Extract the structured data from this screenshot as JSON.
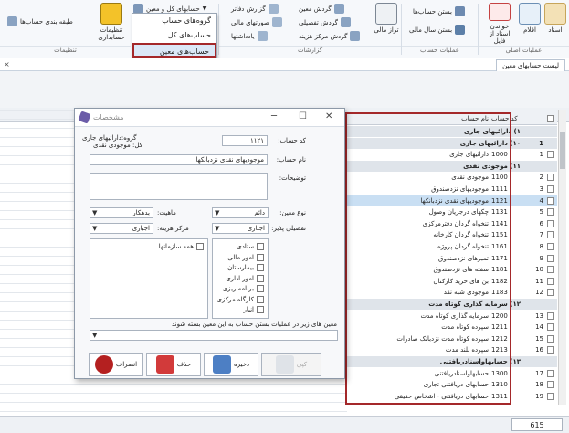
{
  "ribbon": {
    "groups": {
      "basic_ops": "عملیات اصلی",
      "account_ops": "عملیات حساب",
      "reports": "گزارشات",
      "settings": "تنظیمات"
    },
    "big_buttons": {
      "documents": "اسناد",
      "items": "اقلام",
      "read_doc": "خواندن اسناد از فایل",
      "accounting_settings": "تنظیمات حسابداری",
      "group_accounts": "طبقه بندی حساب‌ها"
    },
    "small_buttons": {
      "close_accounts": "بستن حساب‌ها",
      "close_fiscal_year": "بستن سال مالی",
      "trial_balance": "تراز مالی",
      "ledger_flow": "گردش معین",
      "detailed_flow": "گردش تفصیلی",
      "cost_center_flow": "گردش مرکز هزینه",
      "journal_report": "گزارش دفاتر",
      "financial_statements": "صورتهای مالی",
      "notes": "یادداشتها",
      "ledger_accounts": "حسابهای کل و معین"
    },
    "dropdown_items": [
      "گروه‌های حساب",
      "حساب‌های کل",
      "حساب‌های معین"
    ]
  },
  "tab": {
    "label": "لیست حسابهای معین",
    "close": "×"
  },
  "grid": {
    "col_code": "کد حساب",
    "col_name": "نام حساب",
    "rows": [
      {
        "type": "group",
        "text": "۱) دارائیهای جاری"
      },
      {
        "type": "group",
        "text": "۱۰) دارائیهای جاری",
        "num": "1"
      },
      {
        "type": "row",
        "num": "1",
        "code": "1000",
        "name": "دارائیهای جاری"
      },
      {
        "type": "group",
        "text": "۱۱) موجودی نقدی"
      },
      {
        "type": "row",
        "num": "2",
        "code": "1100",
        "name": "موجودی نقدی"
      },
      {
        "type": "row",
        "num": "3",
        "code": "1111",
        "name": "موجودیهای نزدصندوق"
      },
      {
        "type": "row",
        "num": "4",
        "code": "1121",
        "name": "موجودیهای نقدی نزدبانکها",
        "selected": true
      },
      {
        "type": "row",
        "num": "5",
        "code": "1131",
        "name": "چکهای درجریان وصول"
      },
      {
        "type": "row",
        "num": "6",
        "code": "1141",
        "name": "تنخواه گردان دفترمرکزی"
      },
      {
        "type": "row",
        "num": "7",
        "code": "1151",
        "name": "تنخواه گردان کارخانه"
      },
      {
        "type": "row",
        "num": "8",
        "code": "1161",
        "name": "تنخواه گردان پروژه"
      },
      {
        "type": "row",
        "num": "9",
        "code": "1171",
        "name": "تمبرهای نزدصندوق"
      },
      {
        "type": "row",
        "num": "10",
        "code": "1181",
        "name": "سفته های نزدصندوق"
      },
      {
        "type": "row",
        "num": "11",
        "code": "1182",
        "name": "بن های خرید کارکنان"
      },
      {
        "type": "row",
        "num": "12",
        "code": "1183",
        "name": "موجودی شبه نقد"
      },
      {
        "type": "group",
        "text": "۱۲) سرمایه گذاری کوتاه مدت"
      },
      {
        "type": "row",
        "num": "13",
        "code": "1200",
        "name": "سرمایه گذاری کوتاه مدت"
      },
      {
        "type": "row",
        "num": "14",
        "code": "1211",
        "name": "سپرده کوتاه مدت"
      },
      {
        "type": "row",
        "num": "15",
        "code": "1212",
        "name": "سپرده کوتاه مدت نزدبانک صادرات"
      },
      {
        "type": "row",
        "num": "16",
        "code": "1213",
        "name": "سپرده بلند مدت"
      },
      {
        "type": "group",
        "text": "۱۳) حسابهاواسنادریافتنی"
      },
      {
        "type": "row",
        "num": "17",
        "code": "1300",
        "name": "حسابهاواسنادریافتنی"
      },
      {
        "type": "row",
        "num": "18",
        "code": "1310",
        "name": "حسابهای دریافتنی تجاری"
      },
      {
        "type": "row",
        "num": "19",
        "code": "1311",
        "name": "حسابهای دریافتنی - اشخاص حقیقی"
      }
    ],
    "count": "615"
  },
  "dialog": {
    "title": "مشخصات",
    "labels": {
      "code": "کد حساب:",
      "name": "نام حساب:",
      "desc": "توضیحات:",
      "ledger_type": "نوع معین:",
      "nature": "ماهیت:",
      "detailed": "تفصیلی پذیر:",
      "cost_center": "مرکز هزینه:",
      "closing": "معین های زیر در عملیات بستن حساب به این معین بسته شوند"
    },
    "group_info": {
      "group": "گروه:دارائیهای جاری",
      "general": "کل: موجودی نقدی"
    },
    "values": {
      "code": "۱۱۲۱",
      "name": "موجودیهای نقدی نزدبانکها",
      "ledger_type": "دائم",
      "nature": "بدهکار",
      "detailed": "اجباری",
      "cost_center": "اجباری"
    },
    "list_left_header": "همه سازمانها",
    "list_right": [
      "ستادی",
      "امور مالی",
      "بیمارستان",
      "امور اداری",
      "برنامه ریزی",
      "کارگاه مرکزی",
      "انبار"
    ],
    "buttons": {
      "new": "کپی",
      "save": "ذخیره",
      "delete": "حذف",
      "cancel": "انصراف"
    }
  }
}
